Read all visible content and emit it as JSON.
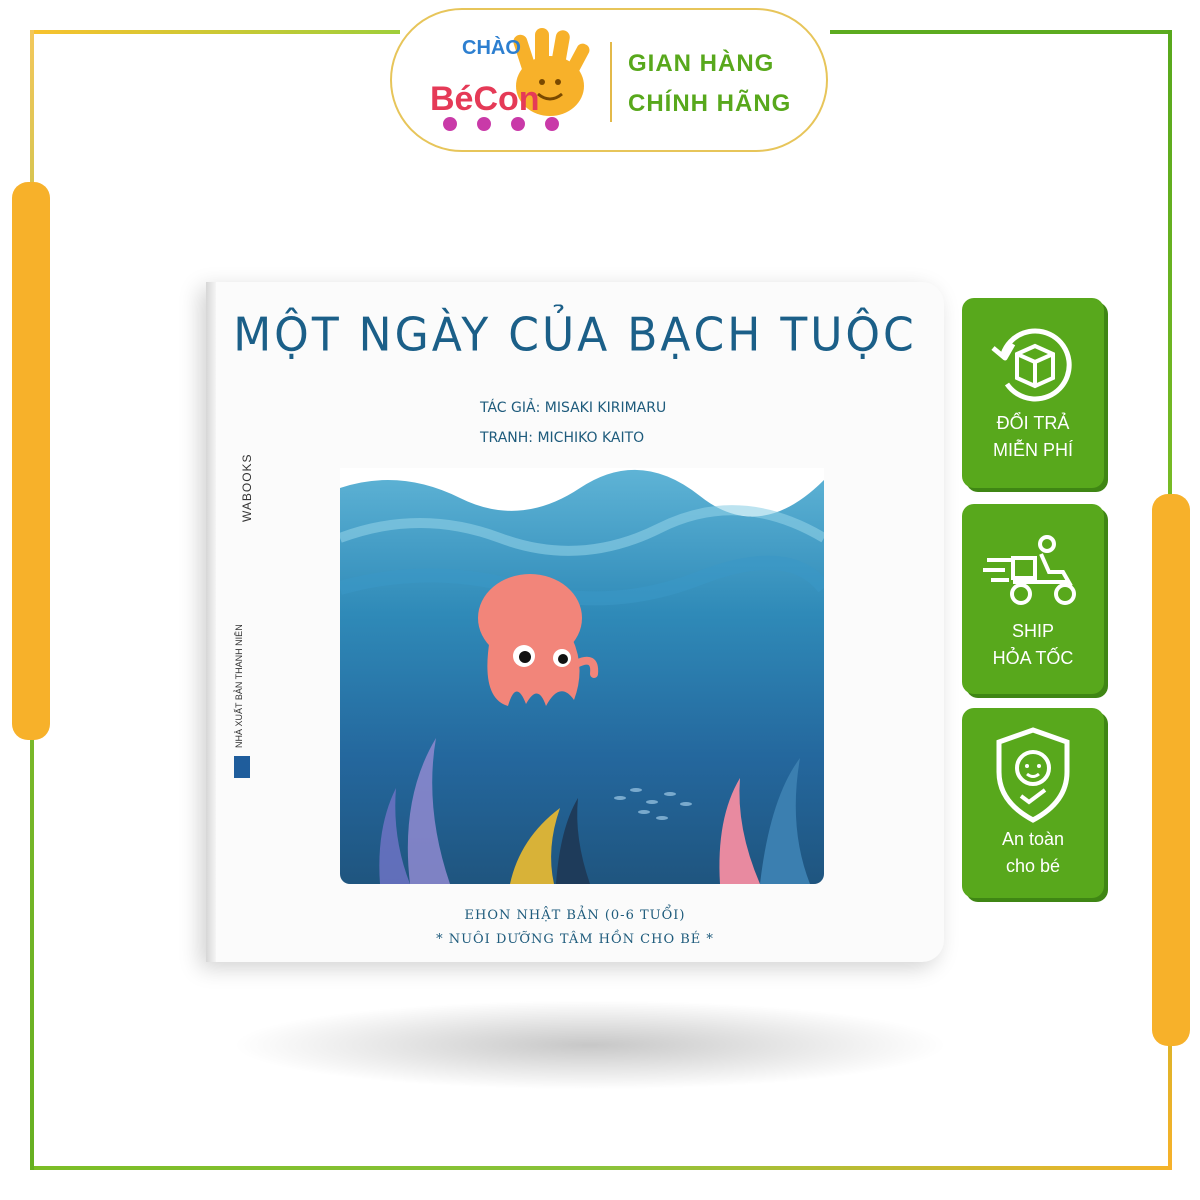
{
  "brand": {
    "logo_text": "BéCon",
    "logo_top": "CHÀO",
    "badge_line1": "GIAN HÀNG",
    "badge_line2": "CHÍNH HÃNG"
  },
  "book": {
    "title": "MỘT NGÀY CỦA BẠCH TUỘC",
    "author": "TÁC GIẢ: MISAKI KIRIMARU",
    "illustrator": "TRANH: MICHIKO KAITO",
    "spine_publisher": "WABOOKS",
    "spine_house": "NHÀ XUẤT BẢN THANH NIÊN",
    "series_line": "EHON NHẬT BẢN (0-6 TUỔI)",
    "tagline": "* NUÔI DƯỠNG TÂM HỒN CHO BÉ *"
  },
  "features": [
    {
      "icon": "return-box-icon",
      "line1": "ĐỔI TRẢ",
      "line2": "MIỄN PHÍ"
    },
    {
      "icon": "delivery-scooter-icon",
      "line1": "SHIP",
      "line2": "HỎA TỐC"
    },
    {
      "icon": "baby-shield-icon",
      "line1": "An toàn",
      "line2": "cho bé"
    }
  ],
  "colors": {
    "frame_green": "#58a81c",
    "accent_orange": "#f7b12a",
    "title_blue": "#1b5f88"
  }
}
